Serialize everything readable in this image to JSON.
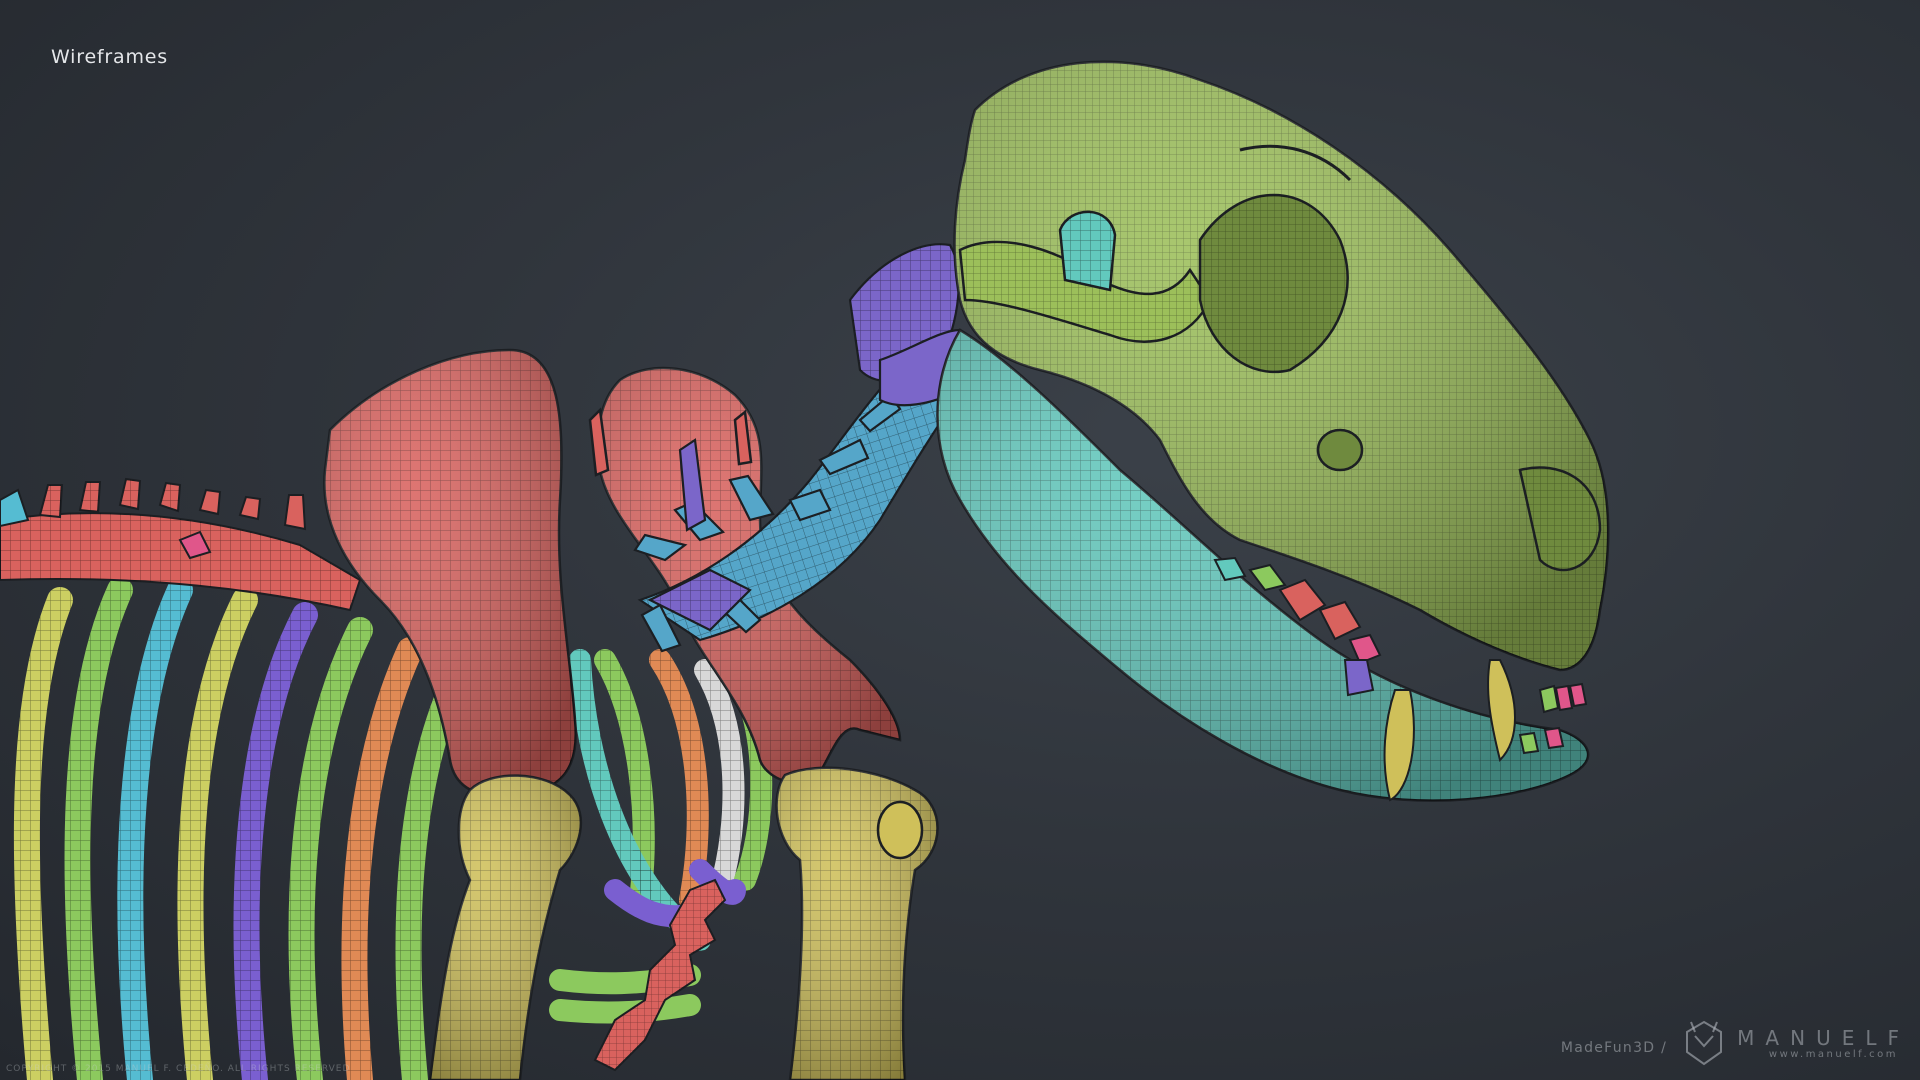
{
  "view": {
    "title": "Wireframes"
  },
  "copyright": {
    "text": "COPYRIGHT © 2015 MANUEL F. CEDEÑO. ALL RIGHTS RESERVED"
  },
  "watermark": {
    "studio": "MadeFun3D /",
    "brand": "MANUELF",
    "url": "www.manuelf.com",
    "logo_icon": "helmet-logo-icon"
  },
  "palette": {
    "background": "#30353c",
    "skull": "#9cbf5a",
    "jaw": "#62c9bd",
    "scapula": "#d9625e",
    "cervical_vertebrae": "#55a6c9",
    "vertebra_purple": "#7b66c9",
    "humerus": "#cfc05a",
    "rib_green": "#8cc95e",
    "rib_yellow": "#cccf62",
    "rib_blue": "#55bcd2",
    "rib_orange": "#e08a55",
    "rib_purple": "#7a5fd0",
    "rib_white": "#d8d8d8",
    "tooth_pink": "#e0568a"
  }
}
